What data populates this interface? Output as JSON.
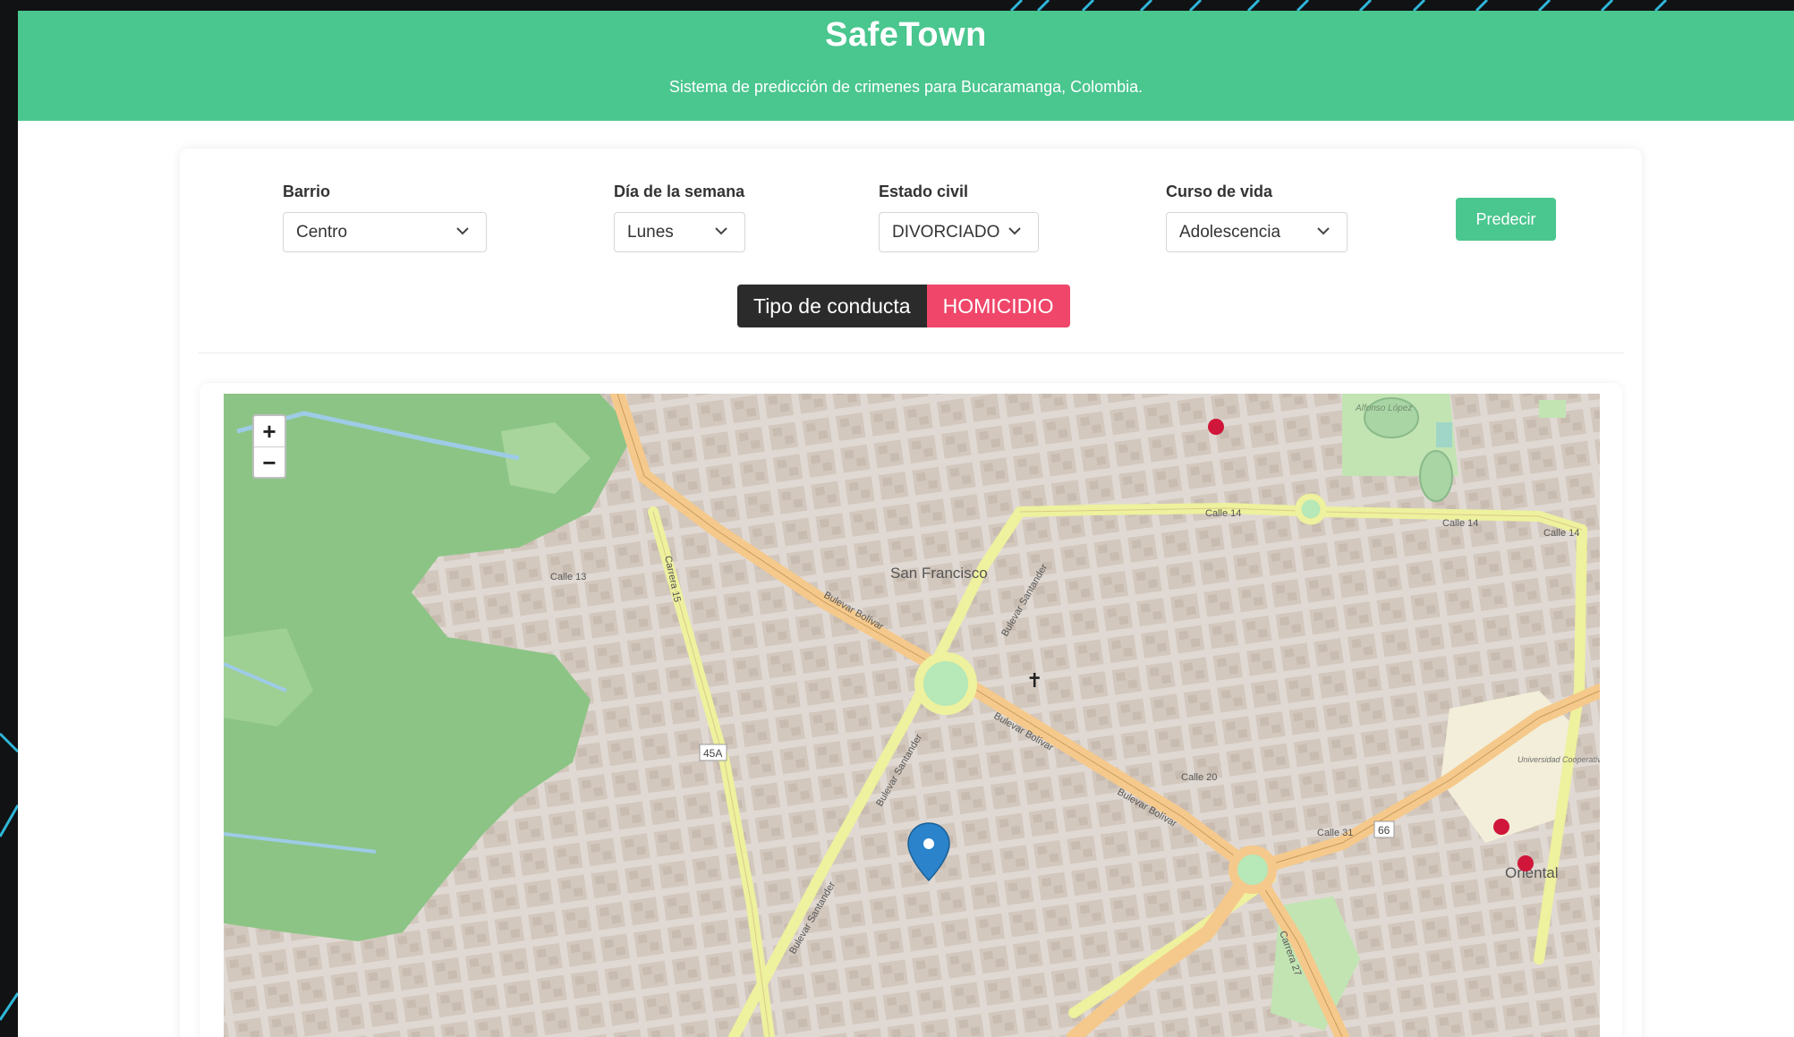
{
  "header": {
    "title": "SafeTown",
    "subtitle": "Sistema de predicción de crimenes para Bucaramanga, Colombia."
  },
  "form": {
    "barrio": {
      "label": "Barrio",
      "value": "Centro"
    },
    "dia": {
      "label": "Día de la semana",
      "value": "Lunes"
    },
    "estado": {
      "label": "Estado civil",
      "value": "DIVORCIADO"
    },
    "curso": {
      "label": "Curso de vida",
      "value": "Adolescencia"
    },
    "predict_label": "Predecir"
  },
  "result": {
    "label": "Tipo de conducta",
    "value": "HOMICIDIO"
  },
  "map": {
    "zoom_in": "+",
    "zoom_out": "−",
    "place_labels": {
      "san_francisco": "San Francisco",
      "oriental": "Oriental",
      "alfonso_lopez": "Alfonso López",
      "universidad": "Universidad Cooperativa de Colombia"
    },
    "street_labels": {
      "bulevar_bolivar_1": "Bulevar Bolívar",
      "bulevar_bolivar_2": "Bulevar Bolívar",
      "bulevar_bolivar_3": "Bulevar Bolívar",
      "bulevar_santander_1": "Bulevar Santander",
      "bulevar_santander_2": "Bulevar Santander",
      "bulevar_santander_3": "Bulevar Santander",
      "calle_14_a": "Calle 14",
      "calle_14_b": "Calle 14",
      "calle_14_c": "Calle 14",
      "calle_31": "Calle 31",
      "calle_13": "Calle 13",
      "calle_20": "Calle 20",
      "carrera_15": "Carrera 15",
      "carrera_27": "Carrera 27",
      "ruta_45a": "45A",
      "ruta_66": "66"
    },
    "colors": {
      "urban": "#e0d9d3",
      "block": "#d5cbc2",
      "park": "#8cc486",
      "main_road": "#f5c98b",
      "secondary_road": "#eef19d",
      "marker": "#2a83cb"
    }
  }
}
